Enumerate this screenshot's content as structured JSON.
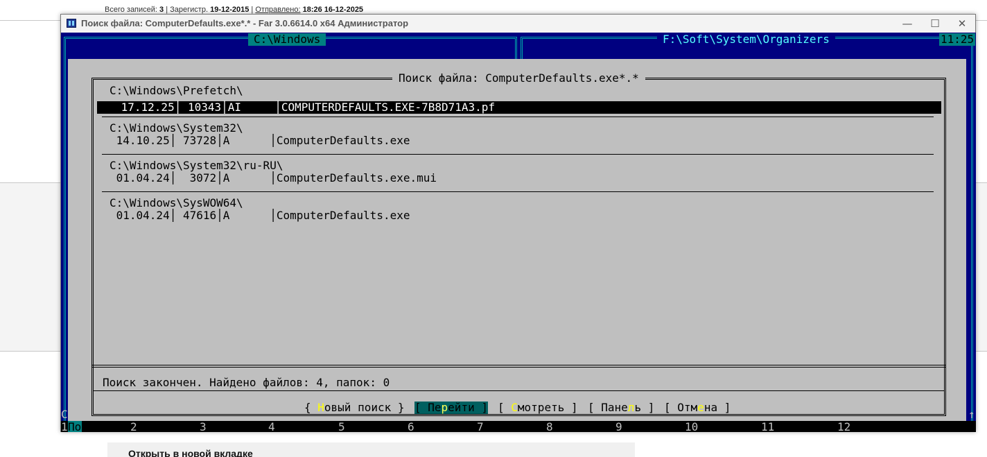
{
  "background": {
    "info_line": {
      "total_label": "Всего записей:",
      "total_value": "3",
      "reg_label": "Зарегистр.",
      "reg_value": "19-12-2015",
      "sent_label": "Отправлено:",
      "sent_value": "18:26 16-12-2025"
    },
    "context_menu_item": "Открыть в новой вкладке"
  },
  "window": {
    "title": "Поиск файла: ComputerDefaults.exe*.* - Far 3.0.6614.0 x64 Администратор",
    "minimize_glyph": "—",
    "maximize_glyph": "☐",
    "close_glyph": "✕"
  },
  "panels": {
    "left_title": "C:\\Windows",
    "right_title": "F:\\Soft\\System\\Organizers",
    "clock": "11:25"
  },
  "dialog": {
    "title": "Поиск файла: ComputerDefaults.exe*.*",
    "groups": [
      {
        "folder": "C:\\Windows\\Prefetch\\",
        "row": " 17.12.25│ 10343│AI     │COMPUTERDEFAULTS.EXE-7B8D71A3.pf",
        "selected": true
      },
      {
        "folder": "C:\\Windows\\System32\\",
        "row": " 14.10.25│ 73728│A      │ComputerDefaults.exe",
        "selected": false
      },
      {
        "folder": "C:\\Windows\\System32\\ru-RU\\",
        "row": " 01.04.24│  3072│A      │ComputerDefaults.exe.mui",
        "selected": false
      },
      {
        "folder": "C:\\Windows\\SysWOW64\\",
        "row": " 01.04.24│ 47616│A      │ComputerDefaults.exe",
        "selected": false
      }
    ],
    "status": "Поиск закончен. Найдено файлов: 4, папок: 0",
    "buttons": {
      "new_search": {
        "pre": "{ ",
        "hot": "Н",
        "post": "овый поиск }"
      },
      "goto": {
        "pre": "[ Пе",
        "hot": "р",
        "post": "ейти ]"
      },
      "view": {
        "pre": "[ ",
        "hot": "С",
        "post": "мотреть ]"
      },
      "panel": {
        "pre": "[ Пане",
        "hot": "л",
        "post": "ь ]"
      },
      "cancel": {
        "pre": "[ Отм",
        "hot": "е",
        "post": "на ]"
      }
    }
  },
  "keybar": {
    "left_char": "C",
    "right_char": "↑",
    "keys": [
      {
        "num": "1",
        "label": "По"
      },
      {
        "num": "2",
        "label": ""
      },
      {
        "num": "3",
        "label": ""
      },
      {
        "num": "4",
        "label": ""
      },
      {
        "num": "5",
        "label": ""
      },
      {
        "num": "6",
        "label": ""
      },
      {
        "num": "7",
        "label": ""
      },
      {
        "num": "8",
        "label": ""
      },
      {
        "num": "9",
        "label": ""
      },
      {
        "num": "10",
        "label": ""
      },
      {
        "num": "11",
        "label": ""
      },
      {
        "num": "12",
        "label": ""
      }
    ]
  },
  "colors": {
    "console_bg": "#000080",
    "dialog_bg": "#bfbfbf",
    "panel_title_bg": "#008080",
    "right_panel_text": "#55ffff",
    "hotkey": "#ffff00",
    "focused_button": "#006060"
  }
}
